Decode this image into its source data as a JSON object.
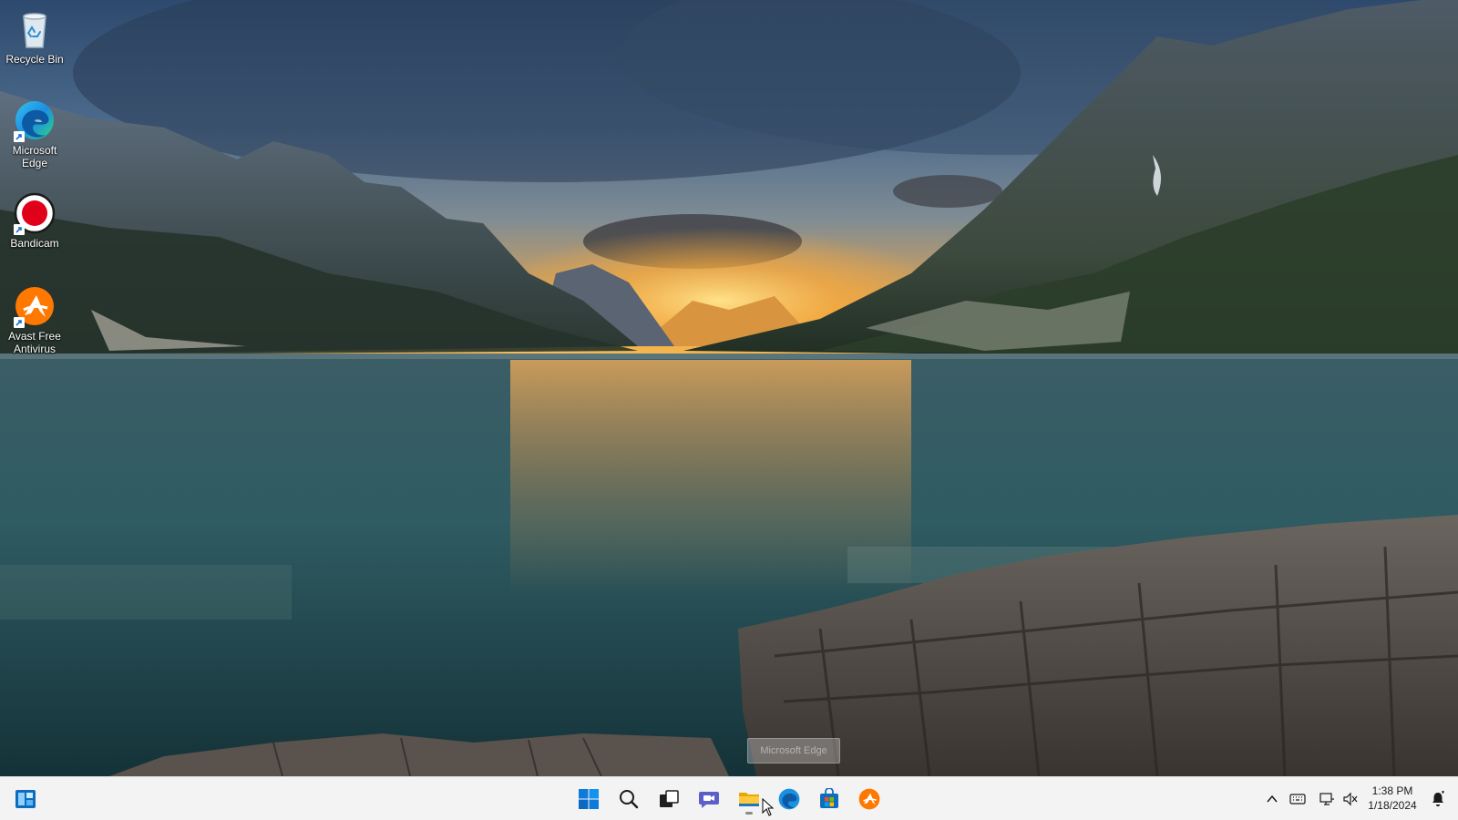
{
  "desktop": {
    "icons": [
      {
        "label": "Recycle Bin",
        "icon": "recycle-bin-icon"
      },
      {
        "label": "Microsoft Edge",
        "icon": "edge-icon"
      },
      {
        "label": "Bandicam",
        "icon": "bandicam-icon"
      },
      {
        "label": "Avast Free Antivirus",
        "icon": "avast-icon"
      }
    ],
    "tooltip": "Microsoft Edge"
  },
  "taskbar": {
    "left": [
      {
        "name": "widgets",
        "icon": "widgets-icon"
      }
    ],
    "apps": [
      {
        "name": "start",
        "icon": "windows-logo-icon"
      },
      {
        "name": "search",
        "icon": "search-icon"
      },
      {
        "name": "task-view",
        "icon": "task-view-icon"
      },
      {
        "name": "chat",
        "icon": "chat-icon"
      },
      {
        "name": "file-explorer",
        "icon": "folder-icon"
      },
      {
        "name": "microsoft-edge",
        "icon": "edge-icon"
      },
      {
        "name": "microsoft-store",
        "icon": "store-icon"
      },
      {
        "name": "avast",
        "icon": "avast-icon"
      }
    ],
    "tray": {
      "icons": [
        "chevron-up-icon",
        "keyboard-icon",
        "network-icon",
        "volume-icon"
      ],
      "time": "1:38 PM",
      "date": "1/18/2024",
      "notification_icon": "notification-bell-icon"
    }
  },
  "colors": {
    "taskbar_bg": "#f3f3f3",
    "windows_blue": "#0078d4",
    "avast_orange": "#ff7800",
    "bandicam_red": "#e0001a"
  }
}
